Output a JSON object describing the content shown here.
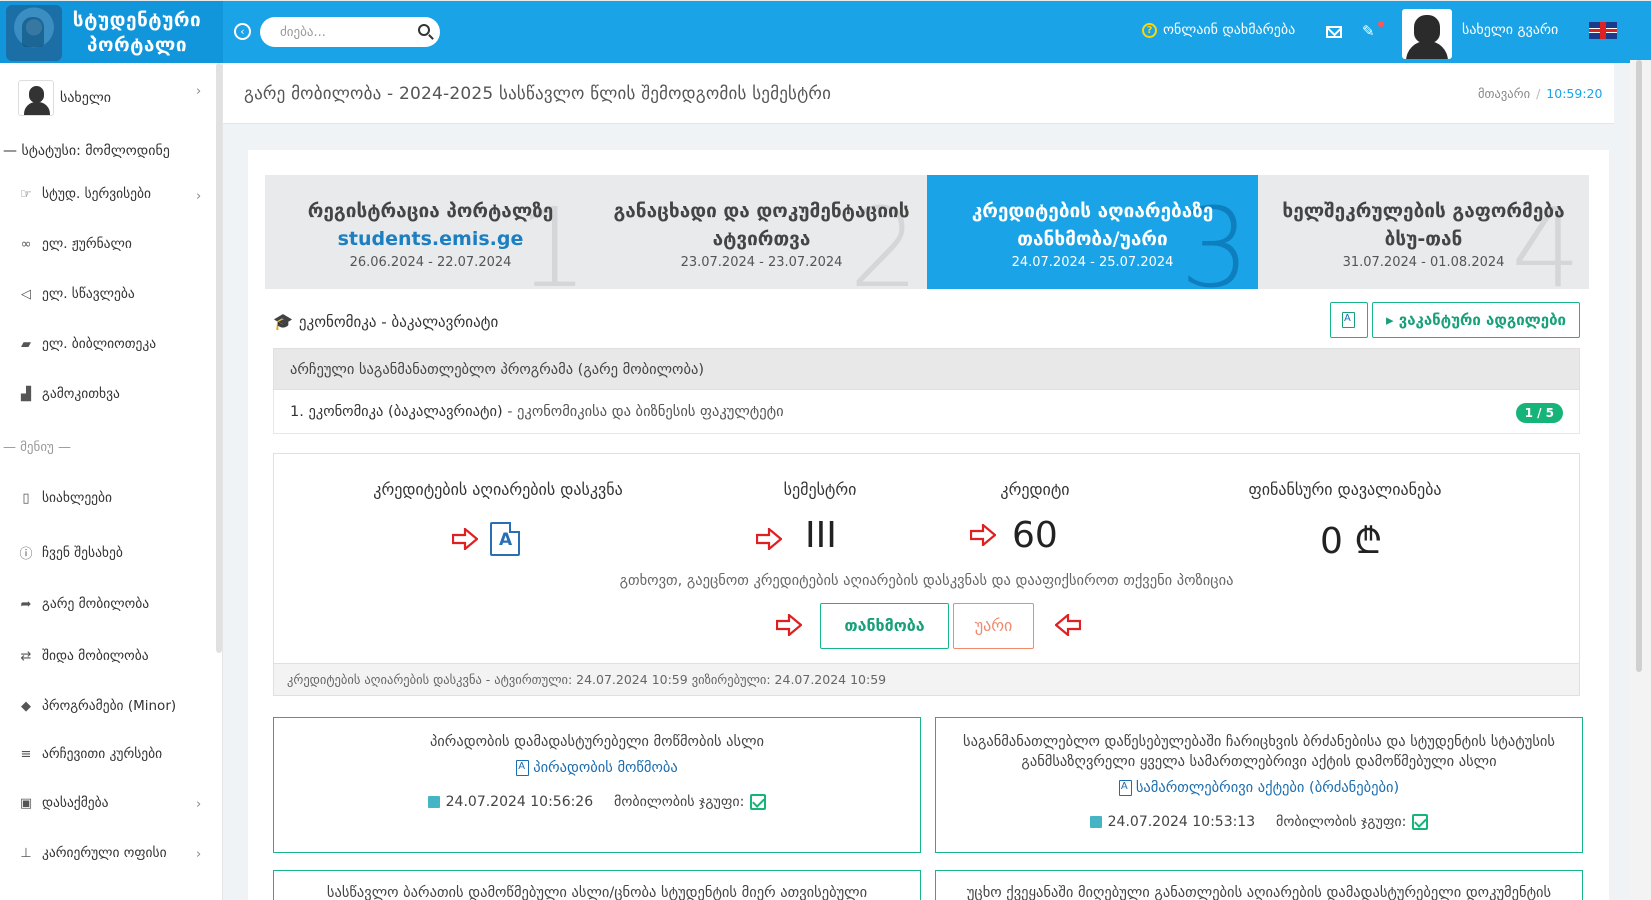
{
  "header": {
    "logo_text": "სტუდენტური პორტალი",
    "search_placeholder": "ძიება...",
    "help_label": "ონლაინ დახმარება",
    "user_name": "სახელი გვარი"
  },
  "sidebar": {
    "profile_name": "სახელი",
    "status": "— სტატუსი: მომლოდინე",
    "items": [
      {
        "label": "სტუდ. სერვისები",
        "icon": "thumb-icon"
      },
      {
        "label": "ელ. ჟურნალი",
        "icon": "link-icon"
      },
      {
        "label": "ელ. სწავლება",
        "icon": "megaphone-icon"
      },
      {
        "label": "ელ. ბიბლიოთეკა",
        "icon": "book-icon"
      },
      {
        "label": "გამოკითხვა",
        "icon": "bar-chart-icon"
      }
    ],
    "section": "— მენიუ —",
    "menu": [
      {
        "label": "სიახლეები",
        "icon": "clipboard-icon"
      },
      {
        "label": "ჩვენ შესახებ",
        "icon": "info-icon"
      },
      {
        "label": "გარე მობილობა",
        "icon": "share-icon"
      },
      {
        "label": "შიდა მობილობა",
        "icon": "shuffle-icon"
      },
      {
        "label": "პროგრამები (Minor)",
        "icon": "graduation-icon"
      },
      {
        "label": "არჩევითი კურსები",
        "icon": "database-icon"
      },
      {
        "label": "დასაქმება",
        "icon": "briefcase-icon"
      },
      {
        "label": "კარიერული ოფისი",
        "icon": "chair-icon"
      }
    ]
  },
  "page": {
    "title": "გარე მობილობა - 2024-2025 სასწავლო წლის შემოდგომის სემესტრი",
    "breadcrumb_home": "მთავარი",
    "breadcrumb_sep": "/",
    "time": "10:59:20"
  },
  "steps": [
    {
      "num": "1",
      "title": "რეგისტრაცია პორტალზე",
      "link": "students.emis.ge",
      "dates": "26.06.2024 - 22.07.2024"
    },
    {
      "num": "2",
      "title": "განაცხადი და დოკუმენტაციის ატვირთვა",
      "dates": "23.07.2024 - 23.07.2024"
    },
    {
      "num": "3",
      "title": "კრედიტების აღიარებაზე თანხმობა/უარი",
      "dates": "24.07.2024 - 25.07.2024"
    },
    {
      "num": "4",
      "title": "ხელშეკრულების გაფორმება ბსუ-თან",
      "dates": "31.07.2024 - 01.08.2024"
    }
  ],
  "program": {
    "heading": "ეკონომიკა - ბაკალავრიატი",
    "vacancies_button": "ვაკანტური ადგილები",
    "table_header": "არჩეული საგანმანათლებლო პროგრამა (გარე მობილობა)",
    "row_name": "1. ეკონომიკა (ბაკალავრიატი)",
    "row_faculty": " - ეკონომიკისა და ბიზნესის ფაკულტეტი",
    "badge": "1 / 5"
  },
  "credits": {
    "col1": "კრედიტების აღიარების დასკვნა",
    "col2": "სემესტრი",
    "col3": "კრედიტი",
    "col4": "ფინანსური დავალიანება",
    "semester": "III",
    "credit": "60",
    "debt": "0 ₾",
    "notice": "გთხოვთ, გაეცნოთ კრედიტების აღიარების დასკვნას და დააფიქსიროთ თქვენი პოზიცია",
    "agree": "თანხმობა",
    "refuse": "უარი",
    "footer": "კრედიტების აღიარების დასკვნა - ატვირთული: 24.07.2024 10:59 ვიზირებული: 24.07.2024 10:59"
  },
  "documents": [
    {
      "title": "პირადობის დამადასტურებელი მოწმობის ასლი",
      "link": "პირადობის მოწმობა",
      "date": "24.07.2024 10:56:26",
      "group_label": "მობილობის ჯგუფი:"
    },
    {
      "title": "საგანმანათლებლო დაწესებულებაში ჩარიცხვის ბრძანებისა და სტუდენტის სტატუსის განმსაზღვრელი ყველა სამართლებრივი აქტის დამოწმებული ასლი",
      "link": "სამართლებრივი აქტები (ბრძანებები)",
      "date": "24.07.2024 10:53:13",
      "group_label": "მობილობის ჯგუფი:"
    },
    {
      "title": "სასწავლო ბარათის დამოწმებული ასლი/ცნობა სტუდენტის მიერ ათვისებული"
    },
    {
      "title": "უცხო ქვეყანაში მიღებული განათლების აღიარების დამადასტურებელი დოკუმენტის"
    }
  ]
}
